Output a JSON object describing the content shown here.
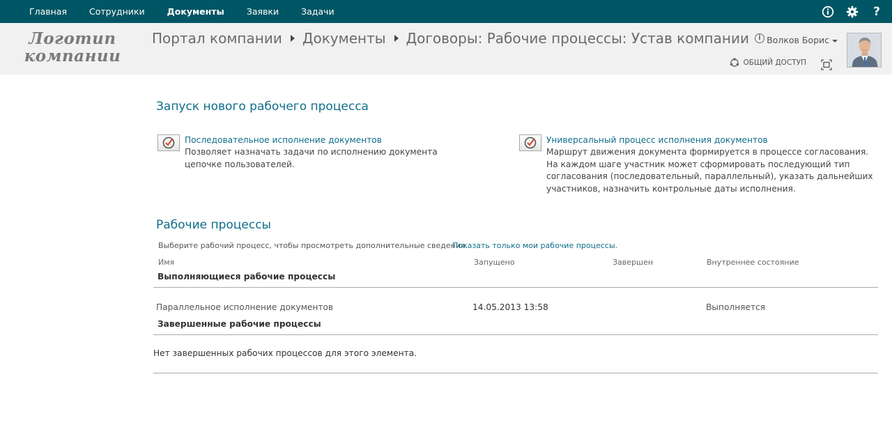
{
  "suitebar": {
    "nav": [
      "Главная",
      "Сотрудники",
      "Документы",
      "Заявки",
      "Задачи"
    ],
    "active_index": 2,
    "icons": [
      "info-icon",
      "gear-icon",
      "help-icon"
    ]
  },
  "header": {
    "logo": "Логотип компании",
    "breadcrumb": [
      "Портал компании",
      "Документы",
      "Договоры: Рабочие процессы: Устав компании"
    ],
    "user_name": "Волков Борис",
    "share_label": "ОБЩИЙ ДОСТУП"
  },
  "launch": {
    "title": "Запуск нового рабочего процесса",
    "workflows": [
      {
        "title": "Последовательное исполнение документов",
        "description": "Позволяет назначать задачи по исполнению документа цепочке пользователей."
      },
      {
        "title": "Универсальный процесс исполнения документов",
        "description": "Маршрут движения документа формируется в процессе согласования. На каждом шаге участник может сформировать последующий тип согласования (последовательный, параллельный), указать дальнейших участников, назначить контрольные даты исполнения."
      }
    ]
  },
  "processes": {
    "title": "Рабочие процессы",
    "hint": "Выберите рабочий процесс, чтобы просмотреть дополнительные сведения.",
    "hint_link": "Показать только мои рабочие процессы.",
    "columns": [
      "Имя",
      "Запущено",
      "Завершен",
      "Внутреннее состояние"
    ],
    "running_header": "Выполняющиеся рабочие процессы",
    "running": [
      {
        "name": "Параллельное исполнение документов",
        "started": "14.05.2013 13:58",
        "finished": "",
        "state": "Выполняется"
      }
    ],
    "completed_header": "Завершенные рабочие процессы",
    "completed_empty": "Нет завершенных рабочих процессов для этого элемента."
  },
  "colors": {
    "suitebar": "#005664",
    "link": "#0f6e8a",
    "header_bg": "#f1f1f1"
  }
}
